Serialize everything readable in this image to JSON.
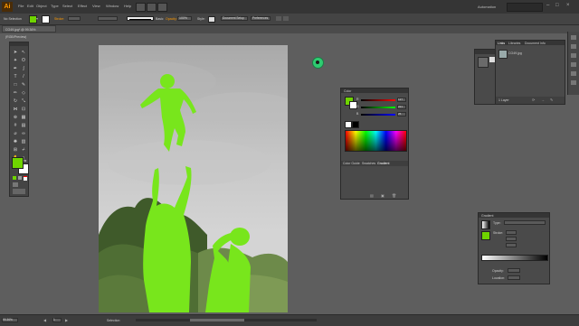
{
  "app": {
    "logo": "Ai",
    "workspace": "Automation"
  },
  "menu": [
    "File",
    "Edit",
    "Object",
    "Type",
    "Select",
    "Effect",
    "View",
    "Window",
    "Help"
  ],
  "control_bar": {
    "selection": "No Selection",
    "stroke_label": "Stroke:",
    "brush_label": "Basic",
    "opacity_label": "Opacity:",
    "opacity_value": "100%",
    "style_label": "Style:",
    "doc_setup": "Document Setup",
    "preferences": "Preferences"
  },
  "document_tab": {
    "label": "CO49.jpg* @ 99.36% (RGB/Preview)"
  },
  "links_panel": {
    "tabs": [
      "Links",
      "Libraries",
      "Document Info"
    ],
    "file": "CO49.jpg",
    "footer": "1 Layer"
  },
  "color_panel": {
    "title": "Color",
    "tabs": [
      "Color Guide",
      "Swatches",
      "Gradient"
    ],
    "channels": [
      {
        "name": "R",
        "value": "127"
      },
      {
        "name": "G",
        "value": "221"
      },
      {
        "name": "B",
        "value": "25"
      }
    ]
  },
  "gradient_panel": {
    "title": "Gradient",
    "type_label": "Type:",
    "stroke_label": "Stroke:",
    "opacity_label": "Opacity:",
    "location_label": "Location:"
  },
  "status_bar": {
    "zoom": "99.36%",
    "page": "1",
    "tool": "Selection"
  },
  "colors": {
    "fill": "#6fd400",
    "accent": "#ff9a00",
    "silhouette": "#78e61c",
    "cursor_dot": "#2ecc71"
  }
}
